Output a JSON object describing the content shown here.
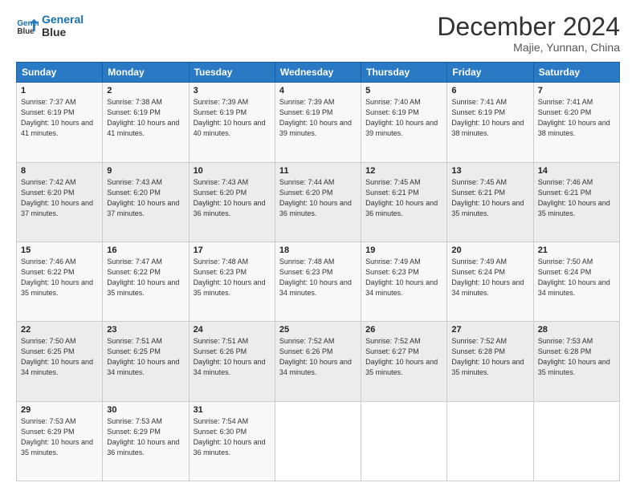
{
  "logo": {
    "line1": "General",
    "line2": "Blue"
  },
  "title": "December 2024",
  "subtitle": "Majie, Yunnan, China",
  "headers": [
    "Sunday",
    "Monday",
    "Tuesday",
    "Wednesday",
    "Thursday",
    "Friday",
    "Saturday"
  ],
  "weeks": [
    [
      {
        "day": "1",
        "sunrise": "7:37 AM",
        "sunset": "6:19 PM",
        "daylight": "10 hours and 41 minutes."
      },
      {
        "day": "2",
        "sunrise": "7:38 AM",
        "sunset": "6:19 PM",
        "daylight": "10 hours and 41 minutes."
      },
      {
        "day": "3",
        "sunrise": "7:39 AM",
        "sunset": "6:19 PM",
        "daylight": "10 hours and 40 minutes."
      },
      {
        "day": "4",
        "sunrise": "7:39 AM",
        "sunset": "6:19 PM",
        "daylight": "10 hours and 39 minutes."
      },
      {
        "day": "5",
        "sunrise": "7:40 AM",
        "sunset": "6:19 PM",
        "daylight": "10 hours and 39 minutes."
      },
      {
        "day": "6",
        "sunrise": "7:41 AM",
        "sunset": "6:19 PM",
        "daylight": "10 hours and 38 minutes."
      },
      {
        "day": "7",
        "sunrise": "7:41 AM",
        "sunset": "6:20 PM",
        "daylight": "10 hours and 38 minutes."
      }
    ],
    [
      {
        "day": "8",
        "sunrise": "7:42 AM",
        "sunset": "6:20 PM",
        "daylight": "10 hours and 37 minutes."
      },
      {
        "day": "9",
        "sunrise": "7:43 AM",
        "sunset": "6:20 PM",
        "daylight": "10 hours and 37 minutes."
      },
      {
        "day": "10",
        "sunrise": "7:43 AM",
        "sunset": "6:20 PM",
        "daylight": "10 hours and 36 minutes."
      },
      {
        "day": "11",
        "sunrise": "7:44 AM",
        "sunset": "6:20 PM",
        "daylight": "10 hours and 36 minutes."
      },
      {
        "day": "12",
        "sunrise": "7:45 AM",
        "sunset": "6:21 PM",
        "daylight": "10 hours and 36 minutes."
      },
      {
        "day": "13",
        "sunrise": "7:45 AM",
        "sunset": "6:21 PM",
        "daylight": "10 hours and 35 minutes."
      },
      {
        "day": "14",
        "sunrise": "7:46 AM",
        "sunset": "6:21 PM",
        "daylight": "10 hours and 35 minutes."
      }
    ],
    [
      {
        "day": "15",
        "sunrise": "7:46 AM",
        "sunset": "6:22 PM",
        "daylight": "10 hours and 35 minutes."
      },
      {
        "day": "16",
        "sunrise": "7:47 AM",
        "sunset": "6:22 PM",
        "daylight": "10 hours and 35 minutes."
      },
      {
        "day": "17",
        "sunrise": "7:48 AM",
        "sunset": "6:23 PM",
        "daylight": "10 hours and 35 minutes."
      },
      {
        "day": "18",
        "sunrise": "7:48 AM",
        "sunset": "6:23 PM",
        "daylight": "10 hours and 34 minutes."
      },
      {
        "day": "19",
        "sunrise": "7:49 AM",
        "sunset": "6:23 PM",
        "daylight": "10 hours and 34 minutes."
      },
      {
        "day": "20",
        "sunrise": "7:49 AM",
        "sunset": "6:24 PM",
        "daylight": "10 hours and 34 minutes."
      },
      {
        "day": "21",
        "sunrise": "7:50 AM",
        "sunset": "6:24 PM",
        "daylight": "10 hours and 34 minutes."
      }
    ],
    [
      {
        "day": "22",
        "sunrise": "7:50 AM",
        "sunset": "6:25 PM",
        "daylight": "10 hours and 34 minutes."
      },
      {
        "day": "23",
        "sunrise": "7:51 AM",
        "sunset": "6:25 PM",
        "daylight": "10 hours and 34 minutes."
      },
      {
        "day": "24",
        "sunrise": "7:51 AM",
        "sunset": "6:26 PM",
        "daylight": "10 hours and 34 minutes."
      },
      {
        "day": "25",
        "sunrise": "7:52 AM",
        "sunset": "6:26 PM",
        "daylight": "10 hours and 34 minutes."
      },
      {
        "day": "26",
        "sunrise": "7:52 AM",
        "sunset": "6:27 PM",
        "daylight": "10 hours and 35 minutes."
      },
      {
        "day": "27",
        "sunrise": "7:52 AM",
        "sunset": "6:28 PM",
        "daylight": "10 hours and 35 minutes."
      },
      {
        "day": "28",
        "sunrise": "7:53 AM",
        "sunset": "6:28 PM",
        "daylight": "10 hours and 35 minutes."
      }
    ],
    [
      {
        "day": "29",
        "sunrise": "7:53 AM",
        "sunset": "6:29 PM",
        "daylight": "10 hours and 35 minutes."
      },
      {
        "day": "30",
        "sunrise": "7:53 AM",
        "sunset": "6:29 PM",
        "daylight": "10 hours and 36 minutes."
      },
      {
        "day": "31",
        "sunrise": "7:54 AM",
        "sunset": "6:30 PM",
        "daylight": "10 hours and 36 minutes."
      },
      null,
      null,
      null,
      null
    ]
  ]
}
